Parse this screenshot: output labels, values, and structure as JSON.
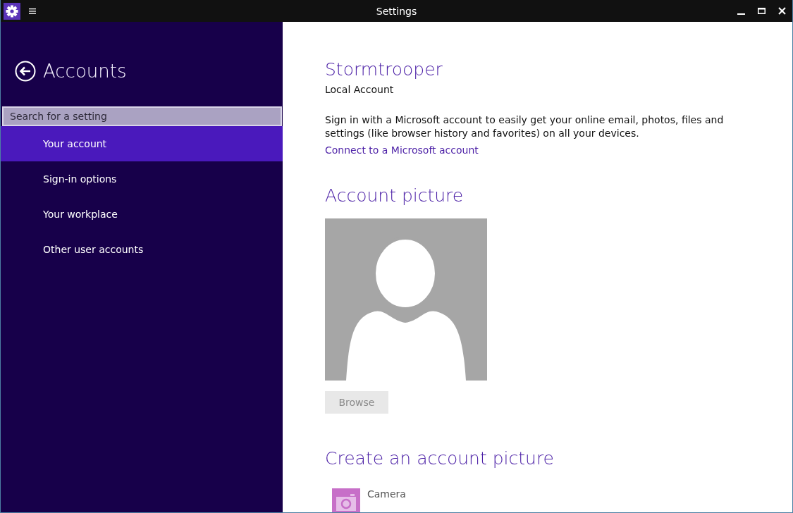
{
  "window": {
    "title": "Settings"
  },
  "sidebar": {
    "title": "Accounts",
    "search": {
      "placeholder": "Search for a setting"
    },
    "items": [
      {
        "label": "Your account",
        "selected": true
      },
      {
        "label": "Sign-in options",
        "selected": false
      },
      {
        "label": "Your workplace",
        "selected": false
      },
      {
        "label": "Other user accounts",
        "selected": false
      }
    ]
  },
  "account": {
    "name": "Stormtrooper",
    "type": "Local Account",
    "description": "Sign in with a Microsoft account to easily get your online email, photos, files and settings (like browser history and favorites) on all your devices.",
    "link": "Connect to a Microsoft account"
  },
  "picture_section": {
    "title": "Account picture",
    "browse_button": {
      "label": "Browse",
      "disabled": true
    }
  },
  "create_section": {
    "title": "Create an account picture",
    "apps": [
      {
        "label": "Camera"
      }
    ]
  }
}
